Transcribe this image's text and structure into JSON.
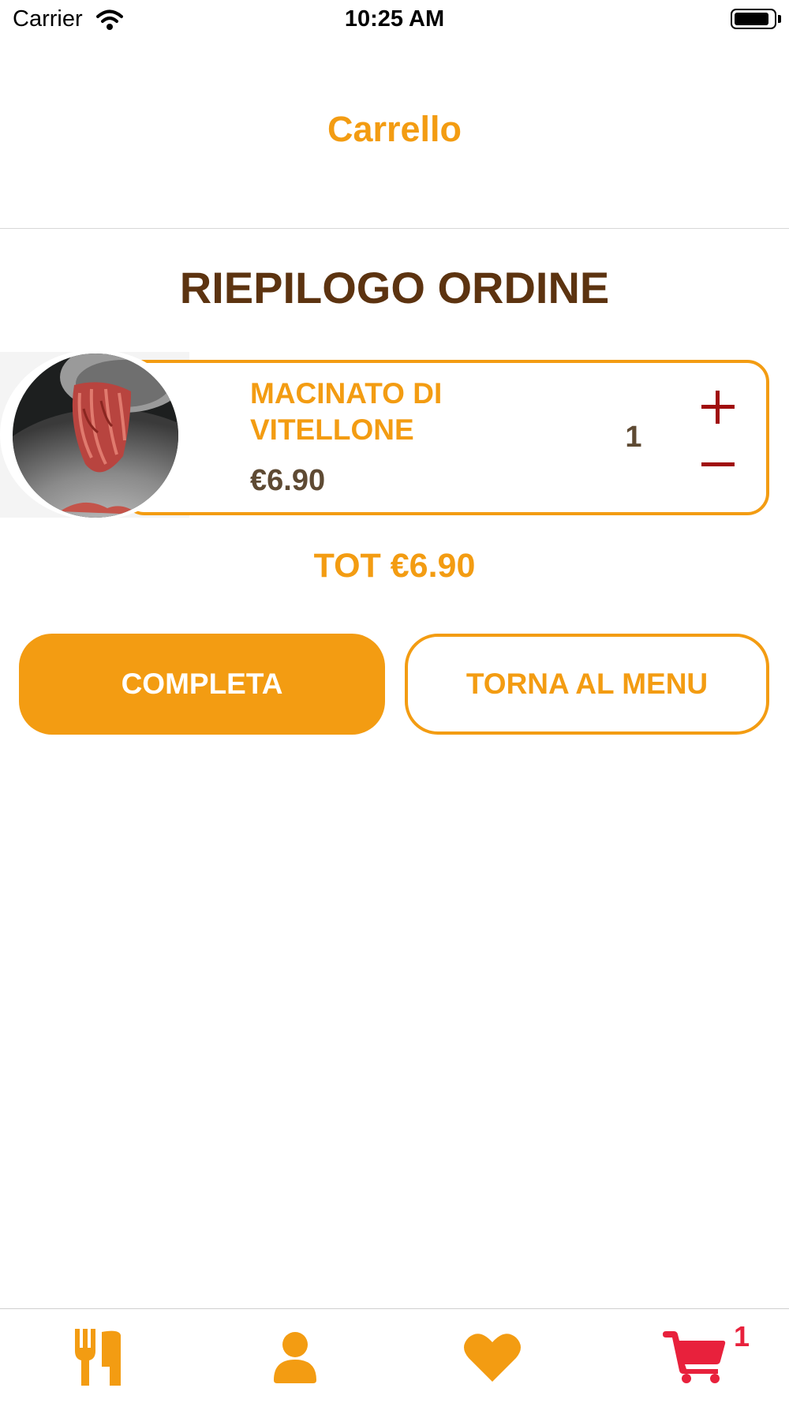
{
  "status_bar": {
    "carrier": "Carrier",
    "time": "10:25 AM",
    "battery_level": 0.9
  },
  "nav": {
    "title": "Carrello"
  },
  "summary": {
    "title": "RIEPILOGO ORDINE"
  },
  "cart": {
    "items": [
      {
        "name": "MACINATO DI VITELLONE",
        "price": "€6.90",
        "quantity": "1",
        "image": "minced-meat-photo"
      }
    ],
    "plus_symbol": "+",
    "minus_symbol": "−"
  },
  "total": "TOT €6.90",
  "actions": {
    "complete_label": "COMPLETA",
    "back_label": "TORNA AL MENU"
  },
  "tabbar": {
    "tabs": [
      {
        "name": "menu",
        "icon": "fork-knife-icon"
      },
      {
        "name": "profile",
        "icon": "user-icon"
      },
      {
        "name": "favorites",
        "icon": "heart-icon"
      },
      {
        "name": "cart",
        "icon": "cart-icon"
      }
    ],
    "cart_badge": "1"
  },
  "colors": {
    "accent": "#F39C12",
    "brown": "#5C3310",
    "price": "#5E4A33",
    "stepper": "#A00E0E",
    "cart_icon": "#E8213C"
  }
}
